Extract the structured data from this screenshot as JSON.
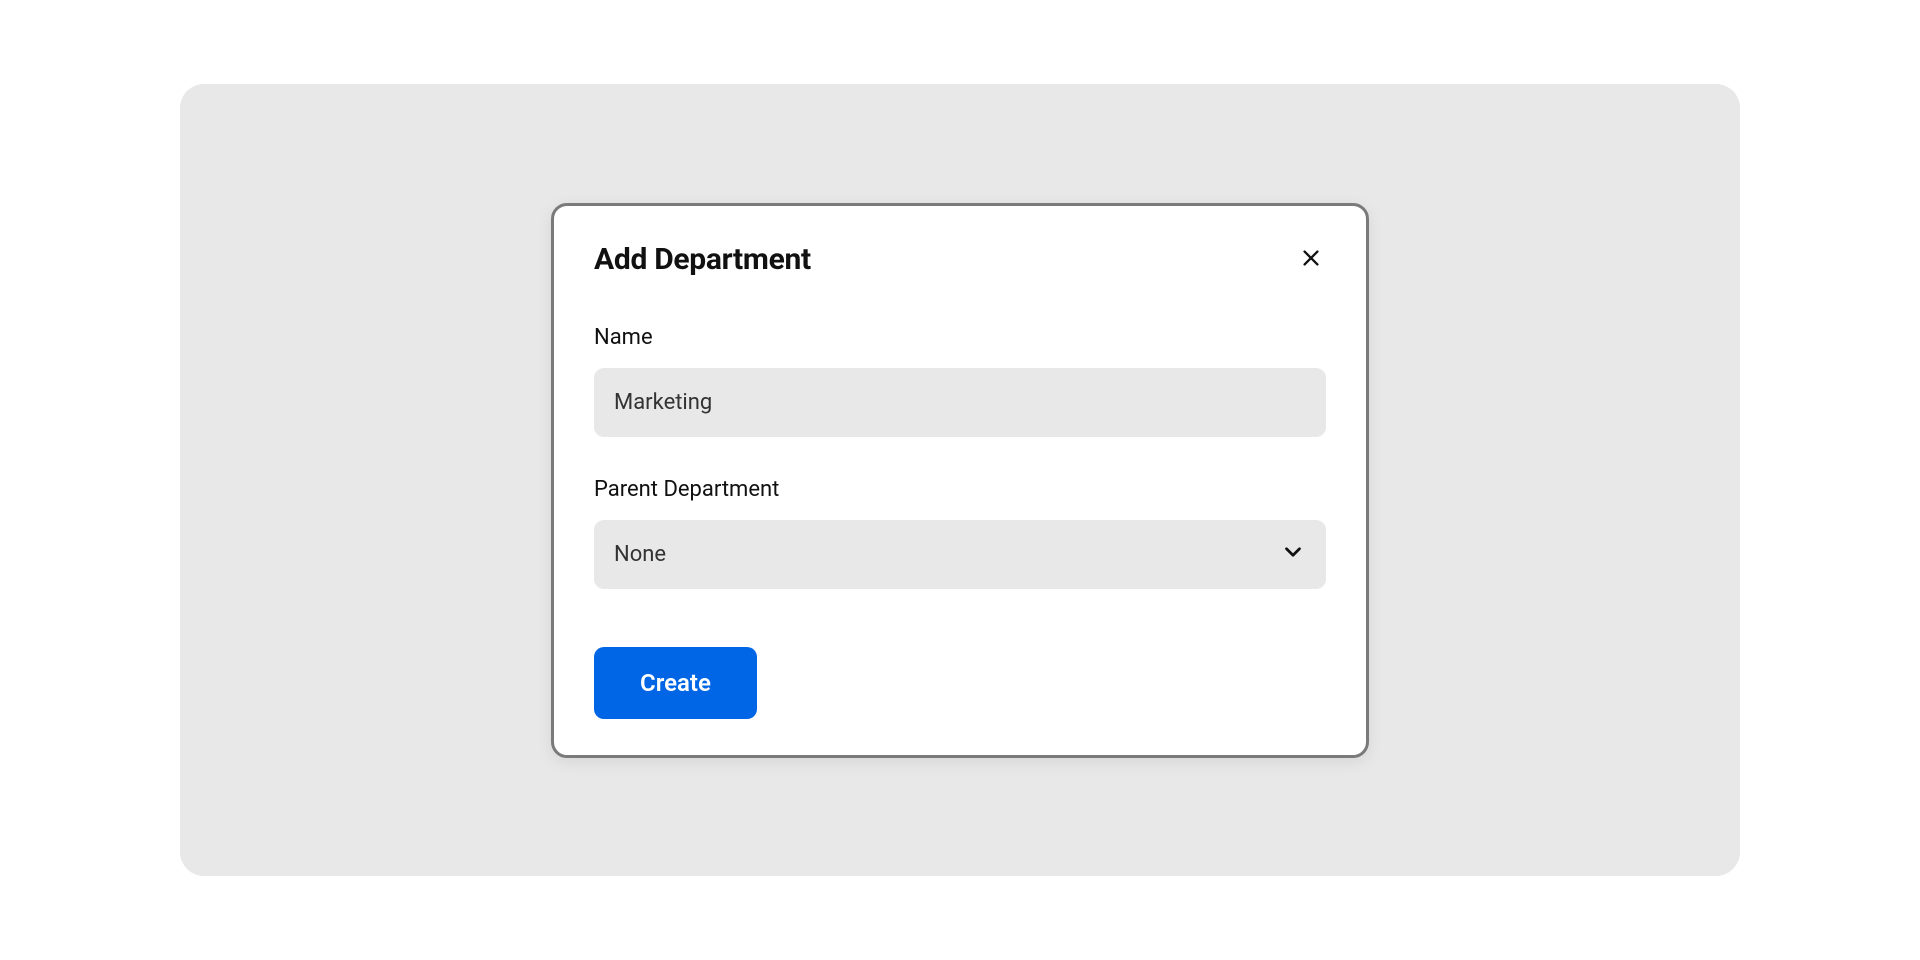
{
  "modal": {
    "title": "Add Department",
    "fields": {
      "name": {
        "label": "Name",
        "value": "Marketing"
      },
      "parent": {
        "label": "Parent Department",
        "value": "None"
      }
    },
    "actions": {
      "create_label": "Create"
    }
  }
}
